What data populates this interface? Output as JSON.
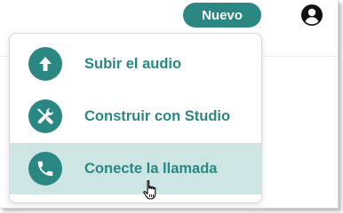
{
  "header": {
    "new_button_label": "Nuevo",
    "account_icon": "account-circle-icon"
  },
  "menu": {
    "items": [
      {
        "label": "Subir el audio",
        "icon": "upload-arrow-icon"
      },
      {
        "label": "Construir con Studio",
        "icon": "tools-icon"
      },
      {
        "label": "Conecte la llamada",
        "icon": "phone-icon",
        "highlighted": true
      }
    ]
  },
  "colors": {
    "accent": "#2a8782",
    "highlight": "#cde6e4"
  }
}
